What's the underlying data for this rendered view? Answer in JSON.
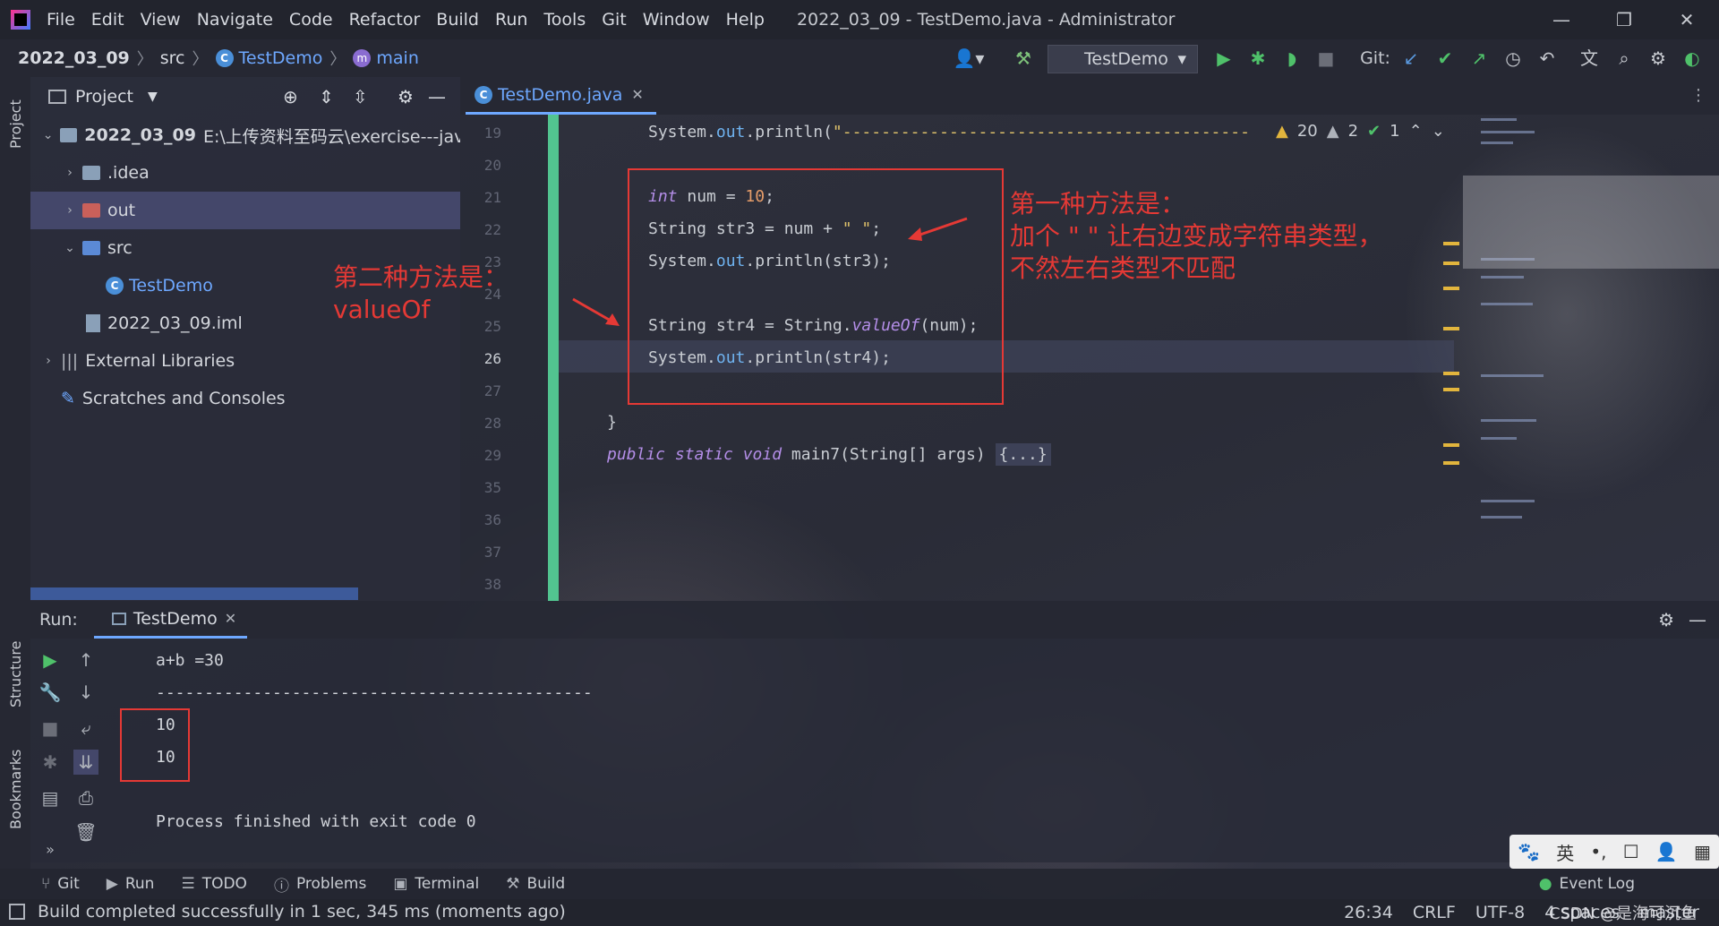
{
  "titlebar": {
    "menu": [
      "File",
      "Edit",
      "View",
      "Navigate",
      "Code",
      "Refactor",
      "Build",
      "Run",
      "Tools",
      "Git",
      "Window",
      "Help"
    ],
    "window_title": "2022_03_09 - TestDemo.java - Administrator",
    "minimize": "—",
    "restore": "❐",
    "close": "✕"
  },
  "navbar": {
    "crumbs": [
      "2022_03_09",
      "src",
      "TestDemo",
      "main"
    ],
    "run_config": "TestDemo",
    "git_label": "Git:"
  },
  "left_stripe": {
    "project": "Project",
    "structure": "Structure",
    "bookmarks": "Bookmarks"
  },
  "project": {
    "title": "Project",
    "tree": [
      {
        "label": "2022_03_09",
        "path": "E:\\上传资料至码云\\exercise---java-cc"
      },
      {
        "label": ".idea"
      },
      {
        "label": "out"
      },
      {
        "label": "src"
      },
      {
        "label": "TestDemo"
      },
      {
        "label": "2022_03_09.iml"
      },
      {
        "label": "External Libraries"
      },
      {
        "label": "Scratches and Consoles"
      }
    ]
  },
  "editor": {
    "tab": "TestDemo.java",
    "line_numbers": [
      "19",
      "20",
      "21",
      "22",
      "23",
      "24",
      "25",
      "26",
      "27",
      "28",
      "29",
      "35",
      "36",
      "37",
      "38"
    ],
    "inspections": {
      "warnings": "20",
      "weak_warnings": "2",
      "typos": "1"
    },
    "code": {
      "l19_a": "System.",
      "l19_b": "out",
      "l19_c": ".println(",
      "l19_d": "\"------------------------------------------",
      "l21_a": "int",
      "l21_b": " num = ",
      "l21_c": "10",
      "l21_d": ";",
      "l22_a": "String str3 = num + ",
      "l22_b": "\" \"",
      "l22_c": ";",
      "l23_a": "System.",
      "l23_b": "out",
      "l23_c": ".println(str3);",
      "l25_a": "String str4 = String.",
      "l25_b": "valueOf",
      "l25_c": "(num);",
      "l26_a": "System.",
      "l26_b": "out",
      "l26_c": ".println(str4);",
      "l28": "}",
      "l29_a": "public static void",
      "l29_b": " main7(String[] args) ",
      "l29_c": "{...}"
    }
  },
  "annotations": {
    "right_1": "第一种方法是：",
    "right_2": "加个 \" \" 让右边变成字符串类型，",
    "right_3": "不然左右类型不匹配",
    "left_1": "第二种方法是：",
    "left_2": "valueOf"
  },
  "run_panel": {
    "label": "Run:",
    "tab": "TestDemo",
    "output": [
      "a+b =30",
      "---------------------------------------------",
      "10",
      "10",
      "",
      "Process finished with exit code 0"
    ]
  },
  "bottom_tools": [
    "Git",
    "Run",
    "TODO",
    "Problems",
    "Terminal",
    "Build",
    "Event Log"
  ],
  "status": {
    "message": "Build completed successfully in 1 sec, 345 ms (moments ago)",
    "position": "26:34",
    "line_sep": "CRLF",
    "encoding": "UTF-8",
    "indent": "4 spaces",
    "branch": "master",
    "watermark": "CSDN @是海可沉鱼"
  },
  "ime": [
    "🐾",
    "英",
    "•,",
    "☐",
    "👤",
    "▦"
  ]
}
